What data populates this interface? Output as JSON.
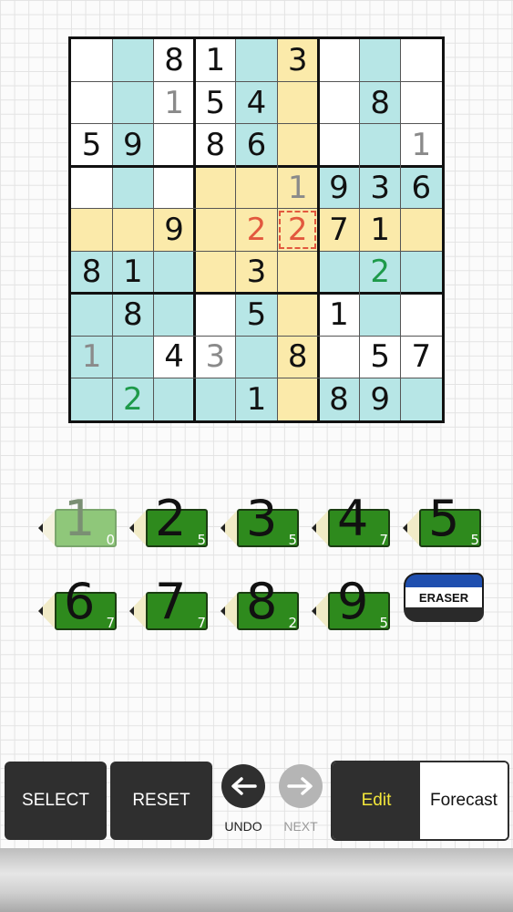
{
  "board": {
    "cells": [
      [
        {
          "v": "",
          "bg": "w"
        },
        {
          "v": "",
          "bg": "b"
        },
        {
          "v": "8",
          "bg": "w"
        },
        {
          "v": "1",
          "bg": "w"
        },
        {
          "v": "",
          "bg": "b"
        },
        {
          "v": "3",
          "bg": "y"
        },
        {
          "v": "",
          "bg": "w"
        },
        {
          "v": "",
          "bg": "b"
        },
        {
          "v": "",
          "bg": "w"
        }
      ],
      [
        {
          "v": "",
          "bg": "w"
        },
        {
          "v": "",
          "bg": "b"
        },
        {
          "v": "1",
          "bg": "w",
          "c": "gray"
        },
        {
          "v": "5",
          "bg": "w"
        },
        {
          "v": "4",
          "bg": "b"
        },
        {
          "v": "",
          "bg": "y"
        },
        {
          "v": "",
          "bg": "w"
        },
        {
          "v": "8",
          "bg": "b"
        },
        {
          "v": "",
          "bg": "w"
        }
      ],
      [
        {
          "v": "5",
          "bg": "w"
        },
        {
          "v": "9",
          "bg": "b"
        },
        {
          "v": "",
          "bg": "w"
        },
        {
          "v": "8",
          "bg": "w"
        },
        {
          "v": "6",
          "bg": "b"
        },
        {
          "v": "",
          "bg": "y"
        },
        {
          "v": "",
          "bg": "w"
        },
        {
          "v": "",
          "bg": "b"
        },
        {
          "v": "1",
          "bg": "w",
          "c": "gray"
        }
      ],
      [
        {
          "v": "",
          "bg": "w"
        },
        {
          "v": "",
          "bg": "b"
        },
        {
          "v": "",
          "bg": "w"
        },
        {
          "v": "",
          "bg": "y"
        },
        {
          "v": "",
          "bg": "y"
        },
        {
          "v": "1",
          "bg": "y",
          "c": "gray"
        },
        {
          "v": "9",
          "bg": "b"
        },
        {
          "v": "3",
          "bg": "b"
        },
        {
          "v": "6",
          "bg": "b"
        }
      ],
      [
        {
          "v": "",
          "bg": "y"
        },
        {
          "v": "",
          "bg": "y"
        },
        {
          "v": "9",
          "bg": "y"
        },
        {
          "v": "",
          "bg": "y"
        },
        {
          "v": "2",
          "bg": "y",
          "c": "red"
        },
        {
          "v": "2",
          "bg": "y",
          "c": "red",
          "hl": true
        },
        {
          "v": "7",
          "bg": "y"
        },
        {
          "v": "1",
          "bg": "y"
        },
        {
          "v": "",
          "bg": "y"
        }
      ],
      [
        {
          "v": "8",
          "bg": "b"
        },
        {
          "v": "1",
          "bg": "b"
        },
        {
          "v": "",
          "bg": "b"
        },
        {
          "v": "",
          "bg": "y"
        },
        {
          "v": "3",
          "bg": "y"
        },
        {
          "v": "",
          "bg": "y"
        },
        {
          "v": "",
          "bg": "b"
        },
        {
          "v": "2",
          "bg": "b",
          "c": "green"
        },
        {
          "v": "",
          "bg": "b"
        }
      ],
      [
        {
          "v": "",
          "bg": "b"
        },
        {
          "v": "8",
          "bg": "b"
        },
        {
          "v": "",
          "bg": "b"
        },
        {
          "v": "",
          "bg": "w"
        },
        {
          "v": "5",
          "bg": "b"
        },
        {
          "v": "",
          "bg": "y"
        },
        {
          "v": "1",
          "bg": "w"
        },
        {
          "v": "",
          "bg": "b"
        },
        {
          "v": "",
          "bg": "w"
        }
      ],
      [
        {
          "v": "1",
          "bg": "b",
          "c": "gray"
        },
        {
          "v": "",
          "bg": "b"
        },
        {
          "v": "4",
          "bg": "w"
        },
        {
          "v": "3",
          "bg": "w",
          "c": "gray"
        },
        {
          "v": "",
          "bg": "b"
        },
        {
          "v": "8",
          "bg": "y"
        },
        {
          "v": "",
          "bg": "w"
        },
        {
          "v": "5",
          "bg": "w"
        },
        {
          "v": "7",
          "bg": "w"
        }
      ],
      [
        {
          "v": "",
          "bg": "b"
        },
        {
          "v": "2",
          "bg": "b",
          "c": "green"
        },
        {
          "v": "",
          "bg": "b"
        },
        {
          "v": "",
          "bg": "b"
        },
        {
          "v": "1",
          "bg": "b"
        },
        {
          "v": "",
          "bg": "y"
        },
        {
          "v": "8",
          "bg": "b"
        },
        {
          "v": "9",
          "bg": "b"
        },
        {
          "v": "",
          "bg": "b"
        }
      ]
    ]
  },
  "palette": {
    "cell_white": "#ffffff",
    "cell_blue": "#b7e6e6",
    "cell_yellow": "#fbeaaa",
    "digit": "#111111",
    "digit_gray": "#8a8a8a",
    "digit_red": "#e2583e",
    "digit_green": "#1e9a4a"
  },
  "pencils": [
    {
      "digit": "1",
      "count": "0",
      "used": true
    },
    {
      "digit": "2",
      "count": "5",
      "used": false
    },
    {
      "digit": "3",
      "count": "5",
      "used": false
    },
    {
      "digit": "4",
      "count": "7",
      "used": false
    },
    {
      "digit": "5",
      "count": "5",
      "used": false
    },
    {
      "digit": "6",
      "count": "7",
      "used": false
    },
    {
      "digit": "7",
      "count": "7",
      "used": false
    },
    {
      "digit": "8",
      "count": "2",
      "used": false
    },
    {
      "digit": "9",
      "count": "5",
      "used": false
    }
  ],
  "eraser": {
    "label": "ERASER"
  },
  "toolbar": {
    "select_label": "SELECT",
    "reset_label": "RESET",
    "undo_label": "UNDO",
    "next_label": "NEXT",
    "edit_label": "Edit",
    "forecast_label": "Forecast"
  }
}
